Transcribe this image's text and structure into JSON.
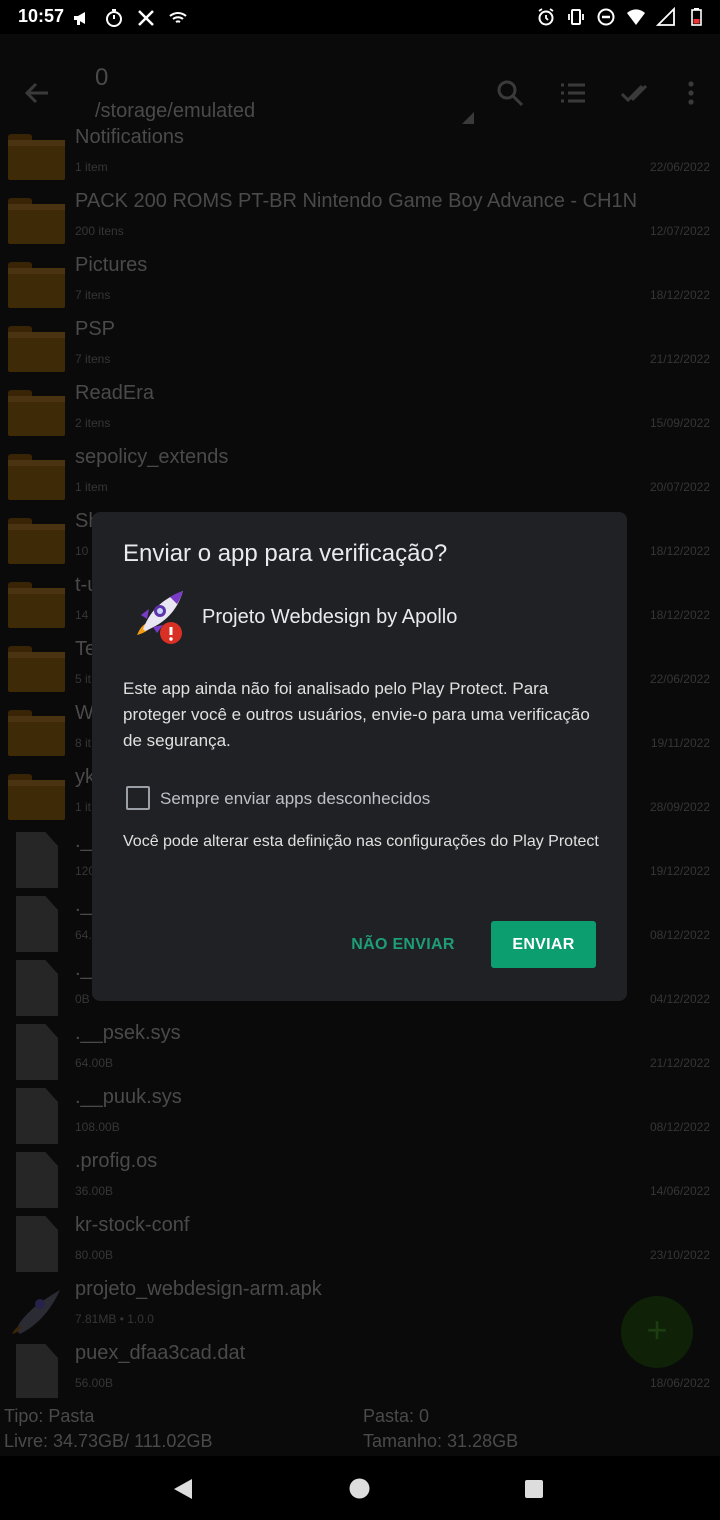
{
  "status_bar": {
    "time": "10:57",
    "left_icons": [
      "megaphone-icon",
      "timer-icon",
      "x-app-icon",
      "wifi-calling-icon"
    ],
    "right_icons": [
      "alarm-icon",
      "vibrate-icon",
      "dnd-icon",
      "wifi-icon",
      "signal-icon",
      "battery-icon"
    ]
  },
  "app_bar": {
    "count": "0",
    "path": "/storage/emulated"
  },
  "files": [
    {
      "type": "folder",
      "name": "Notifications",
      "meta": "1 item",
      "date": "22/06/2022"
    },
    {
      "type": "folder",
      "name": "PACK 200 ROMS PT-BR Nintendo Game Boy Advance - CH1N",
      "meta": "200 itens",
      "date": "12/07/2022"
    },
    {
      "type": "folder",
      "name": "Pictures",
      "meta": "7 itens",
      "date": "18/12/2022"
    },
    {
      "type": "folder",
      "name": "PSP",
      "meta": "7 itens",
      "date": "21/12/2022"
    },
    {
      "type": "folder",
      "name": "ReadEra",
      "meta": "2 itens",
      "date": "15/09/2022"
    },
    {
      "type": "folder",
      "name": "sepolicy_extends",
      "meta": "1 item",
      "date": "20/07/2022"
    },
    {
      "type": "folder",
      "name": "Sh",
      "meta": "10",
      "date": "18/12/2022"
    },
    {
      "type": "folder",
      "name": "t-u",
      "meta": "14",
      "date": "18/12/2022"
    },
    {
      "type": "folder",
      "name": "Te",
      "meta": "5 it",
      "date": "22/06/2022"
    },
    {
      "type": "folder",
      "name": "W",
      "meta": "8 it",
      "date": "19/11/2022"
    },
    {
      "type": "folder",
      "name": "yk",
      "meta": "1 it",
      "date": "28/09/2022"
    },
    {
      "type": "file",
      "name": ".__",
      "meta": "120",
      "date": "19/12/2022"
    },
    {
      "type": "file",
      "name": ".__",
      "meta": "64.",
      "date": "08/12/2022"
    },
    {
      "type": "file",
      "name": ".__",
      "meta": "0B",
      "date": "04/12/2022"
    },
    {
      "type": "file",
      "name": ".__psek.sys",
      "meta": "64.00B",
      "date": "21/12/2022"
    },
    {
      "type": "file",
      "name": ".__puuk.sys",
      "meta": "108.00B",
      "date": "08/12/2022"
    },
    {
      "type": "file",
      "name": ".profig.os",
      "meta": "36.00B",
      "date": "14/06/2022"
    },
    {
      "type": "file",
      "name": "kr-stock-conf",
      "meta": "80.00B",
      "date": "23/10/2022"
    },
    {
      "type": "apk",
      "name": "projeto_webdesign-arm.apk",
      "meta": "7.81MB   •   1.0.0",
      "date": ""
    },
    {
      "type": "file",
      "name": "puex_dfaa3cad.dat",
      "meta": "56.00B",
      "date": "18/06/2022"
    }
  ],
  "bottom_info": {
    "tipo": "Tipo: Pasta",
    "livre": "Livre: 34.73GB/ 111.02GB",
    "pasta": "Pasta: 0",
    "tamanho": "Tamanho: 31.28GB"
  },
  "fab": {
    "label": "+"
  },
  "dialog": {
    "title": "Enviar o app para verificação?",
    "app_name": "Projeto Webdesign by Apollo",
    "message": "Este app ainda não foi analisado pelo Play Protect. Para proteger você e outros usuários, envie-o para uma verificação de segurança.",
    "checkbox_label": "Sempre enviar apps desconhecidos",
    "hint": "Você pode alterar esta definição nas configurações do Play Protect",
    "cancel_label": "NÃO ENVIAR",
    "confirm_label": "ENVIAR",
    "accent_color": "#0d9e70"
  }
}
